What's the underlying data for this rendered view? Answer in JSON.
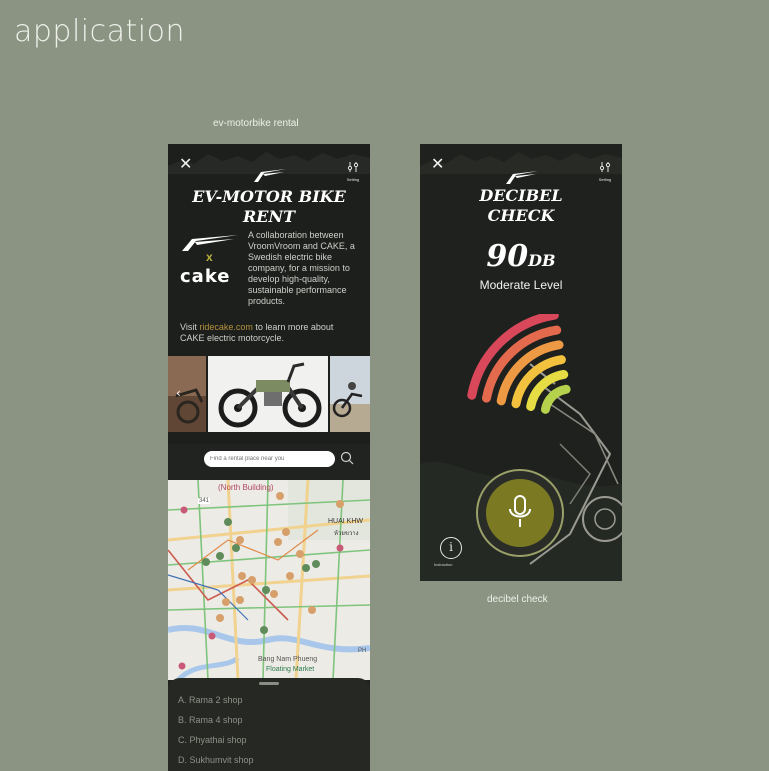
{
  "page": {
    "title": "application",
    "caption_left": "ev-motorbike rental",
    "caption_right": "decibel check"
  },
  "rental": {
    "close_icon": "close-icon",
    "setting_label": "Setting",
    "title_line1": "EV-MOTOR BIKE",
    "title_line2": "RENT",
    "collab_x": "x",
    "cake_logo": "cake",
    "collab_text": "A collaboration between VroomVroom and CAKE, a Swedish electric bike company, for a mission to develop high-quality, sustainable performance products.",
    "visit_prefix": "Visit ",
    "visit_link": "ridecake.com",
    "visit_suffix": " to learn more about CAKE electric motorcycle.",
    "search_placeholder": "Find a rental place near you",
    "map_labels": {
      "north": "(North Building)",
      "huai": "HUAI KHW",
      "huai_th": "ห้วยขวาง",
      "bang": "Bang Nam Phueng",
      "floating": "Floating Market",
      "ph": "PH",
      "b341": "341"
    },
    "shops": [
      "A. Rama 2 shop",
      "B. Rama 4 shop",
      "C. Phyathai shop",
      "D. Sukhumvit shop"
    ]
  },
  "decibel": {
    "setting_label": "Setting",
    "title_line1": "DECIBEL",
    "title_line2": "CHECK",
    "value": "90",
    "unit": "DB",
    "level_text": "Moderate Level",
    "info_label": "Instruction",
    "meter_colors": [
      "#d8485a",
      "#e46a4e",
      "#ee9a45",
      "#f2c23f",
      "#e6dc43",
      "#b6d14c"
    ]
  },
  "colors": {
    "background": "#8b9482",
    "phone": "#212320",
    "accent_olive": "#7b7a23",
    "link": "#b4923e"
  }
}
